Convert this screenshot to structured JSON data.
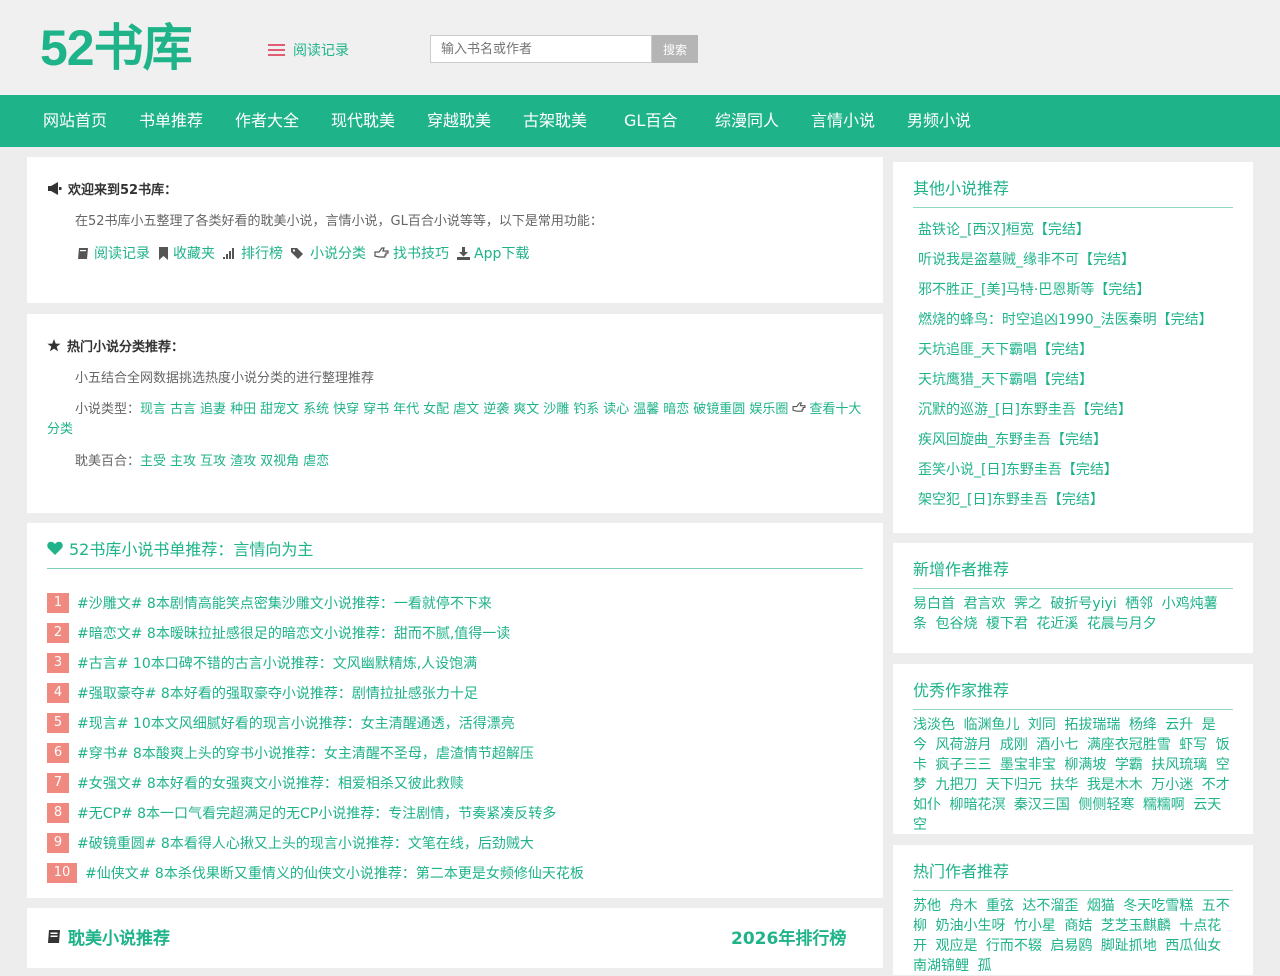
{
  "site": {
    "logo": "52书库",
    "history_label": "阅读记录"
  },
  "search": {
    "placeholder": "输入书名或作者",
    "button": "搜索"
  },
  "nav": [
    "网站首页",
    "书单推荐",
    "作者大全",
    "现代耽美",
    "穿越耽美",
    "古架耽美",
    "GL百合",
    "综漫同人",
    "言情小说",
    "男频小说"
  ],
  "welcome": {
    "title": "欢迎来到52书库：",
    "text": "在52书库小五整理了各类好看的耽美小说，言情小说，GL百合小说等等，以下是常用功能：",
    "links": [
      "阅读记录",
      "收藏夹",
      "排行榜",
      "小说分类",
      "找书技巧",
      "App下载"
    ]
  },
  "hot": {
    "title": "热门小说分类推荐：",
    "intro": "小五结合全网数据挑选热度小说分类的进行整理推荐",
    "type_label": "小说类型：",
    "types": [
      "现言",
      "古言",
      "追妻",
      "种田",
      "甜宠文",
      "系统",
      "快穿",
      "穿书",
      "年代",
      "女配",
      "虐文",
      "逆袭",
      "爽文",
      "沙雕",
      "钓系",
      "读心",
      "温馨",
      "暗恋",
      "破镜重圆",
      "娱乐圈"
    ],
    "more": "查看十大分类",
    "bl_label": "耽美百合：",
    "bl": [
      "主受",
      "主攻",
      "互攻",
      "渣攻",
      "双视角",
      "虐恋"
    ]
  },
  "booklist": {
    "title": "52书库小说书单推荐：言情向为主",
    "items": [
      "#沙雕文# 8本剧情高能笑点密集沙雕文小说推荐：一看就停不下来",
      "#暗恋文# 8本暧昧拉扯感很足的暗恋文小说推荐：甜而不腻,值得一读",
      "#古言# 10本口碑不错的古言小说推荐：文风幽默精炼,人设饱满",
      "#强取豪夺# 8本好看的强取豪夺小说推荐：剧情拉扯感张力十足",
      "#现言# 10本文风细腻好看的现言小说推荐：女主清醒通透，活得漂亮",
      "#穿书# 8本酸爽上头的穿书小说推荐：女主清醒不圣母，虐渣情节超解压",
      "#女强文# 8本好看的女强爽文小说推荐：相爱相杀又彼此救赎",
      "#无CP# 8本一口气看完超满足的无CP小说推荐：专注剧情，节奏紧凑反转多",
      "#破镜重圆# 8本看得人心揪又上头的现言小说推荐：文笔在线，后劲贼大",
      "#仙侠文# 8本杀伐果断又重情义的仙侠文小说推荐：第二本更是女频修仙天花板"
    ]
  },
  "bl_rec": {
    "title": "耽美小说推荐",
    "rank": "2026年排行榜"
  },
  "side_other": {
    "title": "其他小说推荐",
    "items": [
      "盐铁论_[西汉]桓宽【完结】",
      "听说我是盗墓贼_缘非不可【完结】",
      "邪不胜正_[美]马特·巴恩斯等【完结】",
      "燃烧的蜂鸟：时空追凶1990_法医秦明【完结】",
      "天坑追匪_天下霸唱【完结】",
      "天坑鹰猎_天下霸唱【完结】",
      "沉默的巡游_[日]东野圭吾【完结】",
      "疾风回旋曲_东野圭吾【完结】",
      "歪笑小说_[日]东野圭吾【完结】",
      "架空犯_[日]东野圭吾【完结】"
    ]
  },
  "side_new": {
    "title": "新增作者推荐",
    "names": [
      "易白首",
      "君言欢",
      "霁之",
      "破折号yiyi",
      "栖邻",
      "小鸡炖薯条",
      "包谷烧",
      "榎下君",
      "花近溪",
      "花晨与月夕"
    ]
  },
  "side_good": {
    "title": "优秀作家推荐",
    "names": [
      "浅淡色",
      "临渊鱼儿",
      "刘同",
      "拓拔瑞瑞",
      "杨绛",
      "云升",
      "是今",
      "风荷游月",
      "成刚",
      "酒小七",
      "满座衣冠胜雪",
      "虾写",
      "饭卡",
      "疯子三三",
      "墨宝非宝",
      "柳满坡",
      "学霸",
      "扶风琉璃",
      "空梦",
      "九把刀",
      "天下归元",
      "扶华",
      "我是木木",
      "万小迷",
      "不才如仆",
      "柳暗花溟",
      "秦汉三国",
      "侧侧轻寒",
      "糯糯啊",
      "云天空"
    ]
  },
  "side_hot": {
    "title": "热门作者推荐",
    "names": [
      "苏他",
      "舟木",
      "重弦",
      "达不溜歪",
      "烟猫",
      "冬天吃雪糕",
      "五不柳",
      "奶油小生呀",
      "竹小星",
      "商姞",
      "芝芝玉麒麟",
      "十点花开",
      "观应是",
      "行而不辍",
      "启易鸥",
      "脚趾抓地",
      "西瓜仙女",
      "南湖锦鲤",
      "孤"
    ]
  },
  "colors": {
    "accent": "#1fb38a",
    "badge": "#f08a80",
    "icon_list": "#e05d73"
  }
}
